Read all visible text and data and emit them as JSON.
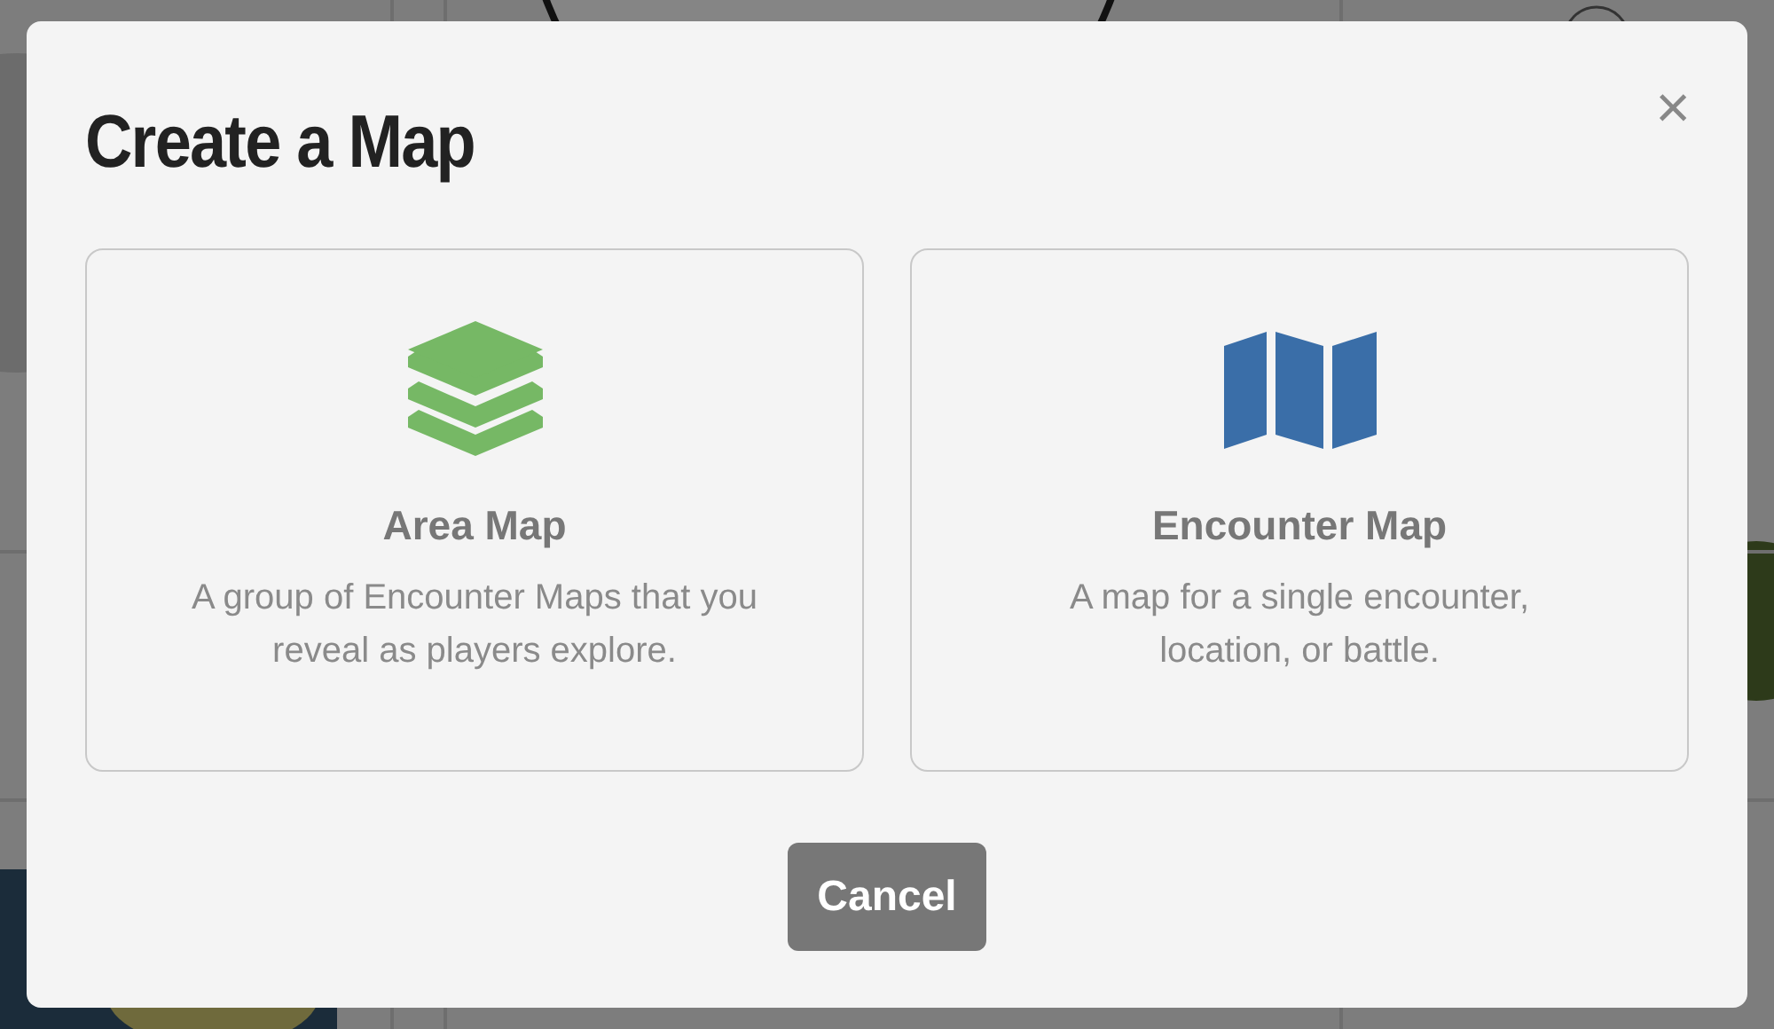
{
  "dialog": {
    "title": "Create a Map",
    "close": "×",
    "options": [
      {
        "kind": "layers",
        "title": "Area Map",
        "description": "A group of Encounter Maps that you reveal as players explore."
      },
      {
        "kind": "map",
        "title": "Encounter Map",
        "description": "A map for a single encounter, location, or battle."
      }
    ],
    "cancel": "Cancel"
  }
}
